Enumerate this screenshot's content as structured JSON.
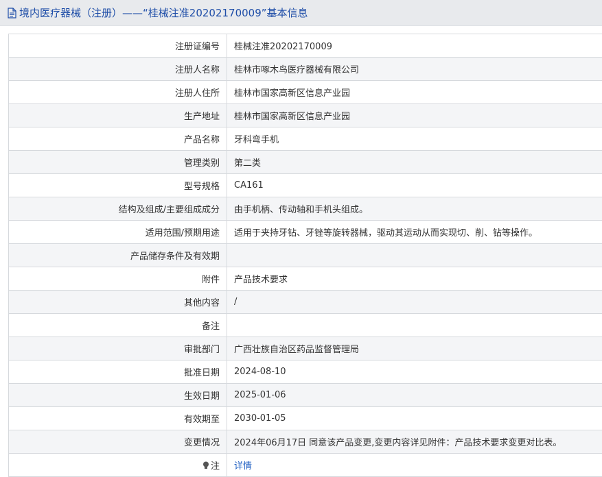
{
  "header": {
    "title": "境内医疗器械（注册）——“桂械注准20202170009”基本信息"
  },
  "rows": [
    {
      "label": "注册证编号",
      "value": "桂械注准20202170009"
    },
    {
      "label": "注册人名称",
      "value": "桂林市啄木鸟医疗器械有限公司"
    },
    {
      "label": "注册人住所",
      "value": "桂林市国家高新区信息产业园"
    },
    {
      "label": "生产地址",
      "value": "桂林市国家高新区信息产业园"
    },
    {
      "label": "产品名称",
      "value": "牙科弯手机"
    },
    {
      "label": "管理类别",
      "value": "第二类"
    },
    {
      "label": "型号规格",
      "value": "CA161"
    },
    {
      "label": "结构及组成/主要组成成分",
      "value": "由手机柄、传动轴和手机头组成。"
    },
    {
      "label": "适用范围/预期用途",
      "value": "适用于夹持牙钻、牙锉等旋转器械，驱动其运动从而实现切、削、钻等操作。"
    },
    {
      "label": "产品储存条件及有效期",
      "value": ""
    },
    {
      "label": "附件",
      "value": "产品技术要求"
    },
    {
      "label": "其他内容",
      "value": "/"
    },
    {
      "label": "备注",
      "value": ""
    },
    {
      "label": "审批部门",
      "value": "广西壮族自治区药品监督管理局"
    },
    {
      "label": "批准日期",
      "value": "2024-08-10"
    },
    {
      "label": "生效日期",
      "value": "2025-01-06"
    },
    {
      "label": "有效期至",
      "value": "2030-01-05"
    },
    {
      "label": "变更情况",
      "value": "2024年06月17日 同意该产品变更,变更内容详见附件：产品技术要求变更对比表。"
    }
  ],
  "note": {
    "label": "注",
    "link": "详情"
  },
  "icons": {
    "title_icon": "document-icon",
    "note_icon": "lightbulb-icon"
  },
  "colors": {
    "title": "#1f4ea8",
    "link": "#1f5fc2",
    "header_bg": "#e8eaed"
  }
}
